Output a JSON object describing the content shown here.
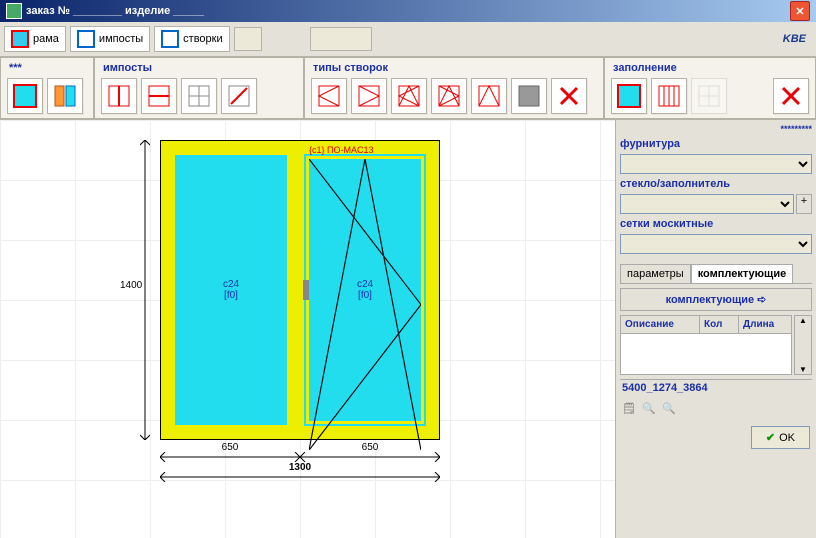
{
  "titlebar": {
    "text": "заказ № ________  изделие _____"
  },
  "topnav": {
    "frame": "рама",
    "imposts": "импосты",
    "sashes": "створки"
  },
  "brand": "KBE",
  "sections": {
    "s0": "***",
    "imposts": "импосты",
    "sash_types": "типы створок",
    "filling": "заполнение"
  },
  "drawing": {
    "height": "1400",
    "width_total": "1300",
    "width_left": "650",
    "width_right": "650",
    "pane1_code": "c24",
    "pane1_sub": "[f0]",
    "pane2_code": "c24",
    "pane2_sub": "[f0]",
    "sash_tag": "{c1} ПО-MAC13"
  },
  "sidebar": {
    "asterisks": "*********",
    "l_furn": "фурнитура",
    "l_glass": "стекло/заполнитель",
    "l_mosq": "сетки москитные",
    "plus": "+",
    "tab_params": "параметры",
    "tab_comp": "комплектующие",
    "btn_comp": "комплектующие",
    "arrow": "➪",
    "col_desc": "Описание",
    "col_qty": "Кол",
    "col_len": "Длина",
    "status": "5400_1274_3864",
    "ok": "OK"
  }
}
